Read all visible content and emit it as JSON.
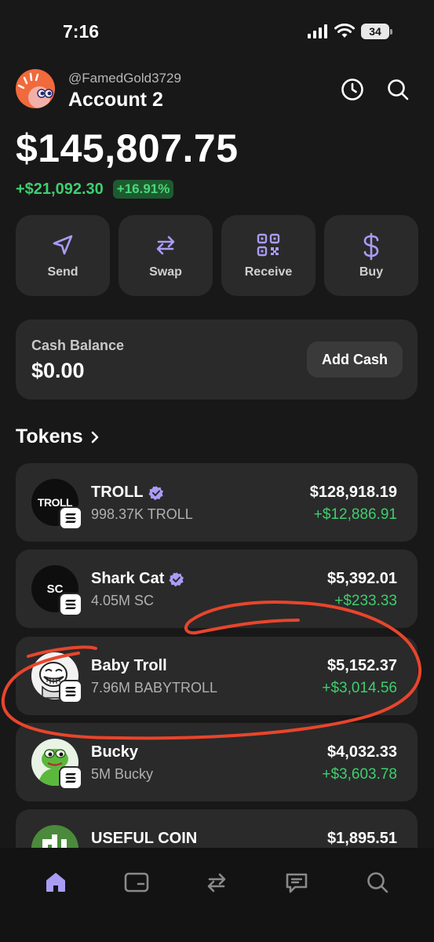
{
  "status_bar": {
    "time": "7:16",
    "battery": "34"
  },
  "header": {
    "handle": "@FamedGold3729",
    "account_name": "Account 2"
  },
  "portfolio": {
    "balance": "$145,807.75",
    "change_amount": "+$21,092.30",
    "change_percent": "+16.91%"
  },
  "actions": [
    {
      "label": "Send",
      "icon": "send-icon"
    },
    {
      "label": "Swap",
      "icon": "swap-icon"
    },
    {
      "label": "Receive",
      "icon": "qr-code-icon"
    },
    {
      "label": "Buy",
      "icon": "dollar-icon"
    }
  ],
  "cash": {
    "title": "Cash Balance",
    "value": "$0.00",
    "button": "Add Cash"
  },
  "tokens_section": {
    "title": "Tokens"
  },
  "tokens": [
    {
      "name": "TROLL",
      "verified": true,
      "amount": "998.37K TROLL",
      "value": "$128,918.19",
      "change": "+$12,886.91",
      "icon_text": "TROLL"
    },
    {
      "name": "Shark Cat",
      "verified": true,
      "amount": "4.05M SC",
      "value": "$5,392.01",
      "change": "+$233.33",
      "icon_text": "SC"
    },
    {
      "name": "Baby Troll",
      "verified": false,
      "amount": "7.96M BABYTROLL",
      "value": "$5,152.37",
      "change": "+$3,014.56",
      "icon_text": ""
    },
    {
      "name": "Bucky",
      "verified": false,
      "amount": "5M Bucky",
      "value": "$4,032.33",
      "change": "+$3,603.78",
      "icon_text": ""
    },
    {
      "name": "USEFUL COIN",
      "verified": false,
      "amount": "",
      "value": "$1,895.51",
      "change": "",
      "icon_text": ""
    }
  ],
  "tab_bar": [
    {
      "name": "home-icon",
      "active": true
    },
    {
      "name": "wallet-card-icon",
      "active": false
    },
    {
      "name": "swap-icon",
      "active": false
    },
    {
      "name": "chat-icon",
      "active": false
    },
    {
      "name": "search-icon",
      "active": false
    }
  ],
  "colors": {
    "accent": "#a99cf5",
    "positive": "#3dcf6e",
    "card": "#2a2a2a",
    "background": "#181818",
    "annotation": "#e8452c"
  }
}
